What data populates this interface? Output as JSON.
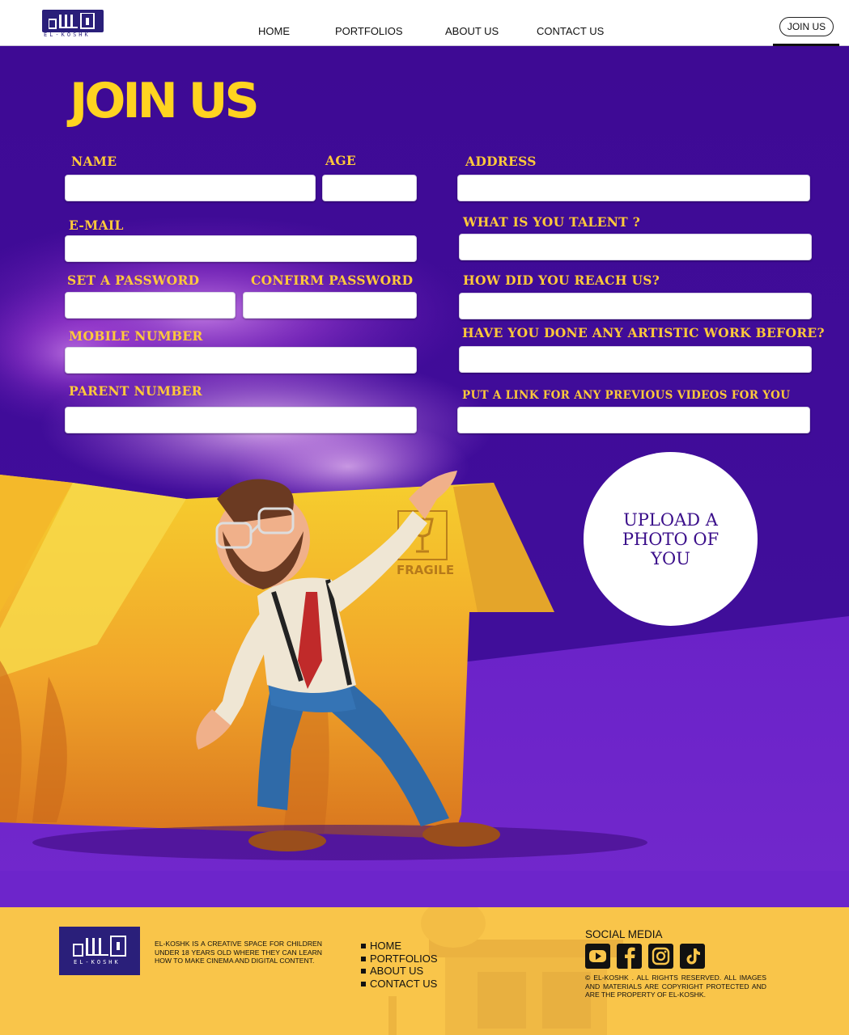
{
  "header": {
    "logo_text": "EL-KOSHK",
    "nav": [
      "HOME",
      "PORTFOLIOS",
      "ABOUT US",
      "CONTACT US"
    ],
    "join_label": "JOIN US"
  },
  "form": {
    "title": "JOIN US",
    "fields": {
      "name": "NAME",
      "age": "AGE",
      "address": "ADDRESS",
      "email": "E-MAIL",
      "talent": "WHAT IS YOU TALENT ?",
      "password": "SET A PASSWORD",
      "confirm_password": "CONFIRM PASSWORD",
      "reach": "HOW DID YOU REACH US?",
      "mobile": "MOBILE NUMBER",
      "artistic": "HAVE YOU DONE ANY ARTISTIC WORK BEFORE?",
      "parent": "PARENT NUMBER",
      "videos": "PUT A LINK FOR ANY PREVIOUS VIDEOS FOR YOU"
    },
    "upload_label": "UPLOAD A PHOTO OF YOU",
    "box_label": "FRAGILE"
  },
  "footer": {
    "logo_text": "EL-KOSHK",
    "about": "EL-KOSHK IS A CREATIVE SPACE FOR CHILDREN UNDER 18 YEARS OLD WHERE THEY CAN LEARN HOW TO MAKE CINEMA AND DIGITAL CONTENT.",
    "nav": [
      "HOME",
      "PORTFOLIOS",
      "ABOUT US",
      "CONTACT US"
    ],
    "social_title": "SOCIAL MEDIA",
    "social_icons": [
      "youtube-icon",
      "facebook-icon",
      "instagram-icon",
      "tiktok-icon"
    ],
    "copyright": "© EL-KOSHK . ALL RIGHTS RESERVED. ALL IMAGES AND MATERIALS ARE COPYRIGHT PROTECTED AND ARE THE PROPERTY OF EL-KOSHK."
  },
  "colors": {
    "purple": "#400c99",
    "yellow": "#ffd320",
    "label": "#ffc93a",
    "footer": "#f9c54a",
    "brand": "#2a1f7a"
  }
}
